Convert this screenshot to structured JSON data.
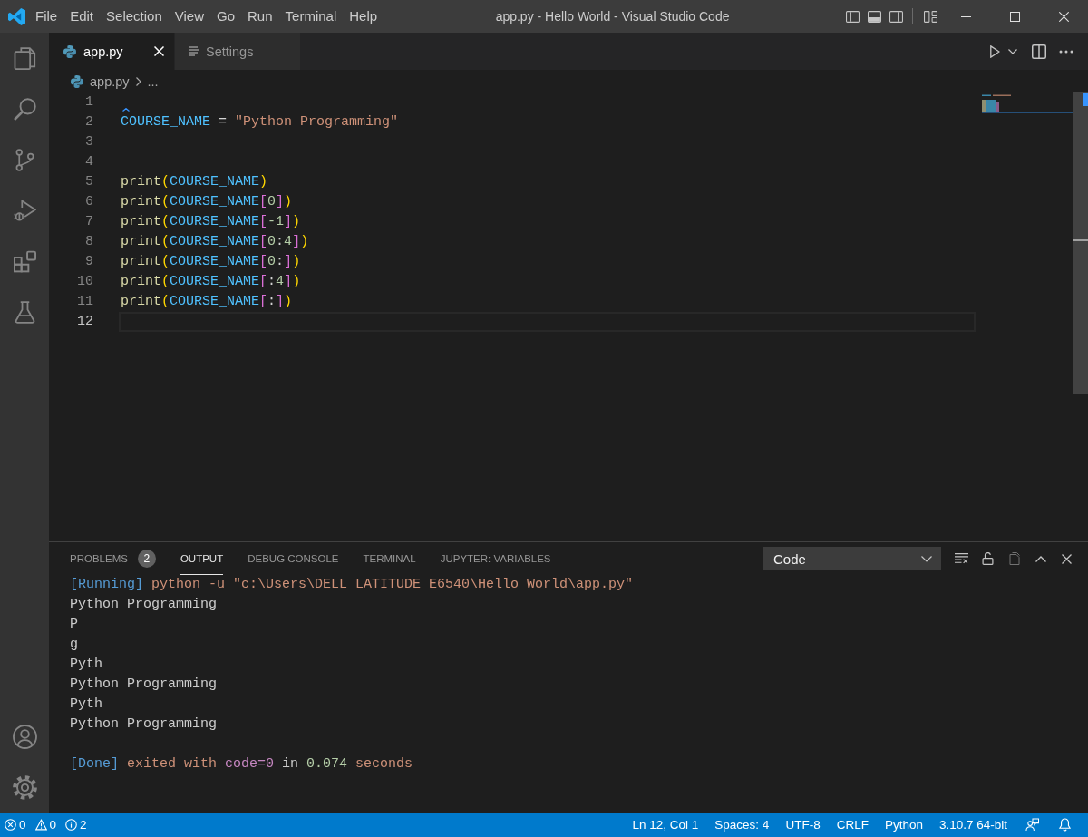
{
  "window": {
    "title": "app.py - Hello World - Visual Studio Code"
  },
  "menu": [
    "File",
    "Edit",
    "Selection",
    "View",
    "Go",
    "Run",
    "Terminal",
    "Help"
  ],
  "layout_toggles": [
    {
      "kind": "primary",
      "on": false
    },
    {
      "kind": "panel",
      "on": true
    },
    {
      "kind": "secondary",
      "on": false
    }
  ],
  "activity_bar": {
    "top": [
      {
        "kind": "explorer",
        "selected": false
      },
      {
        "kind": "search",
        "selected": false
      },
      {
        "kind": "scm",
        "selected": false
      },
      {
        "kind": "debug",
        "selected": false
      },
      {
        "kind": "extensions",
        "selected": false
      },
      {
        "kind": "testing",
        "selected": false
      }
    ],
    "bottom": [
      {
        "kind": "accounts"
      },
      {
        "kind": "manage"
      }
    ]
  },
  "editor_tabs": [
    {
      "kind": "file",
      "label": "app.py",
      "selected": true
    },
    {
      "kind": "settings",
      "label": "Settings",
      "selected": false
    }
  ],
  "breadcrumb": [
    "app.py",
    "..."
  ],
  "editor": {
    "lines": [
      {
        "number": "1",
        "current": false,
        "squiggle": true
      },
      {
        "number": "2",
        "current": false,
        "squiggle": false,
        "tokens": [
          {
            "text": "COURSE_NAME",
            "kind": "constant"
          },
          {
            "text": " = ",
            "kind": "operator"
          },
          {
            "text": "\"Python Programming\"",
            "kind": "string"
          }
        ]
      },
      {
        "number": "3",
        "current": false,
        "squiggle": false
      },
      {
        "number": "4",
        "current": false,
        "squiggle": false
      },
      {
        "number": "5",
        "current": false,
        "squiggle": false,
        "tokens": [
          {
            "text": "print",
            "kind": "function"
          },
          {
            "text": "(",
            "kind": "paren"
          },
          {
            "text": "COURSE_NAME",
            "kind": "constant"
          },
          {
            "text": ")",
            "kind": "paren"
          }
        ]
      },
      {
        "number": "6",
        "current": false,
        "squiggle": false,
        "tokens": [
          {
            "text": "print",
            "kind": "function"
          },
          {
            "text": "(",
            "kind": "paren"
          },
          {
            "text": "COURSE_NAME",
            "kind": "constant"
          },
          {
            "text": "[",
            "kind": "square"
          },
          {
            "text": "0",
            "kind": "number"
          },
          {
            "text": "]",
            "kind": "square"
          },
          {
            "text": ")",
            "kind": "paren"
          }
        ]
      },
      {
        "number": "7",
        "current": false,
        "squiggle": false,
        "tokens": [
          {
            "text": "print",
            "kind": "function"
          },
          {
            "text": "(",
            "kind": "paren"
          },
          {
            "text": "COURSE_NAME",
            "kind": "constant"
          },
          {
            "text": "[",
            "kind": "square"
          },
          {
            "text": "-1",
            "kind": "number"
          },
          {
            "text": "]",
            "kind": "square"
          },
          {
            "text": ")",
            "kind": "paren"
          }
        ]
      },
      {
        "number": "8",
        "current": false,
        "squiggle": false,
        "tokens": [
          {
            "text": "print",
            "kind": "function"
          },
          {
            "text": "(",
            "kind": "paren"
          },
          {
            "text": "COURSE_NAME",
            "kind": "constant"
          },
          {
            "text": "[",
            "kind": "square"
          },
          {
            "text": "0",
            "kind": "number"
          },
          {
            "text": ":",
            "kind": "operator"
          },
          {
            "text": "4",
            "kind": "number"
          },
          {
            "text": "]",
            "kind": "square"
          },
          {
            "text": ")",
            "kind": "paren"
          }
        ]
      },
      {
        "number": "9",
        "current": false,
        "squiggle": false,
        "tokens": [
          {
            "text": "print",
            "kind": "function"
          },
          {
            "text": "(",
            "kind": "paren"
          },
          {
            "text": "COURSE_NAME",
            "kind": "constant"
          },
          {
            "text": "[",
            "kind": "square"
          },
          {
            "text": "0",
            "kind": "number"
          },
          {
            "text": ":",
            "kind": "operator"
          },
          {
            "text": "]",
            "kind": "square"
          },
          {
            "text": ")",
            "kind": "paren"
          }
        ]
      },
      {
        "number": "10",
        "current": false,
        "squiggle": false,
        "tokens": [
          {
            "text": "print",
            "kind": "function"
          },
          {
            "text": "(",
            "kind": "paren"
          },
          {
            "text": "COURSE_NAME",
            "kind": "constant"
          },
          {
            "text": "[",
            "kind": "square"
          },
          {
            "text": ":",
            "kind": "operator"
          },
          {
            "text": "4",
            "kind": "number"
          },
          {
            "text": "]",
            "kind": "square"
          },
          {
            "text": ")",
            "kind": "paren"
          }
        ]
      },
      {
        "number": "11",
        "current": false,
        "squiggle": false,
        "tokens": [
          {
            "text": "print",
            "kind": "function"
          },
          {
            "text": "(",
            "kind": "paren"
          },
          {
            "text": "COURSE_NAME",
            "kind": "constant"
          },
          {
            "text": "[",
            "kind": "square"
          },
          {
            "text": ":",
            "kind": "operator"
          },
          {
            "text": "]",
            "kind": "square"
          },
          {
            "text": ")",
            "kind": "paren"
          }
        ]
      },
      {
        "number": "12",
        "current": true,
        "squiggle": false
      }
    ]
  },
  "panel": {
    "tabs": [
      {
        "label": "PROBLEMS",
        "badge": "2",
        "selected": false
      },
      {
        "label": "OUTPUT",
        "selected": true
      },
      {
        "label": "DEBUG CONSOLE",
        "selected": false
      },
      {
        "label": "TERMINAL",
        "selected": false
      },
      {
        "label": "JUPYTER: VARIABLES",
        "selected": false
      }
    ],
    "channel": {
      "value": "Code"
    },
    "output": {
      "lines": [
        {
          "tokens": [
            {
              "text": "[Running]",
              "kind": "tag"
            },
            {
              "text": " python -u \"c:\\Users\\DELL LATITUDE E6540\\Hello World\\app.py\"",
              "kind": "command"
            }
          ]
        },
        {
          "tokens": [
            {
              "text": "Python Programming",
              "kind": "plain"
            }
          ]
        },
        {
          "tokens": [
            {
              "text": "P",
              "kind": "plain"
            }
          ]
        },
        {
          "tokens": [
            {
              "text": "g",
              "kind": "plain"
            }
          ]
        },
        {
          "tokens": [
            {
              "text": "Pyth",
              "kind": "plain"
            }
          ]
        },
        {
          "tokens": [
            {
              "text": "Python Programming",
              "kind": "plain"
            }
          ]
        },
        {
          "tokens": [
            {
              "text": "Pyth",
              "kind": "plain"
            }
          ]
        },
        {
          "tokens": [
            {
              "text": "Python Programming",
              "kind": "plain"
            }
          ]
        }
      ],
      "summary": [
        {
          "text": "[Done]",
          "kind": "tag"
        },
        {
          "text": " exited with ",
          "kind": "text"
        },
        {
          "text": "code=0",
          "kind": "code"
        },
        {
          "text": " in ",
          "kind": "plain"
        },
        {
          "text": "0.074",
          "kind": "number"
        },
        {
          "text": " seconds",
          "kind": "text"
        }
      ]
    }
  },
  "status_bar": {
    "problems": [
      {
        "kind": "error",
        "count": "0"
      },
      {
        "kind": "warning",
        "count": "0"
      },
      {
        "kind": "info",
        "count": "2"
      }
    ],
    "items": [
      "Ln 12, Col 1",
      "Spaces: 4",
      "UTF-8",
      "CRLF",
      "Python",
      "3.10.7 64-bit"
    ]
  }
}
